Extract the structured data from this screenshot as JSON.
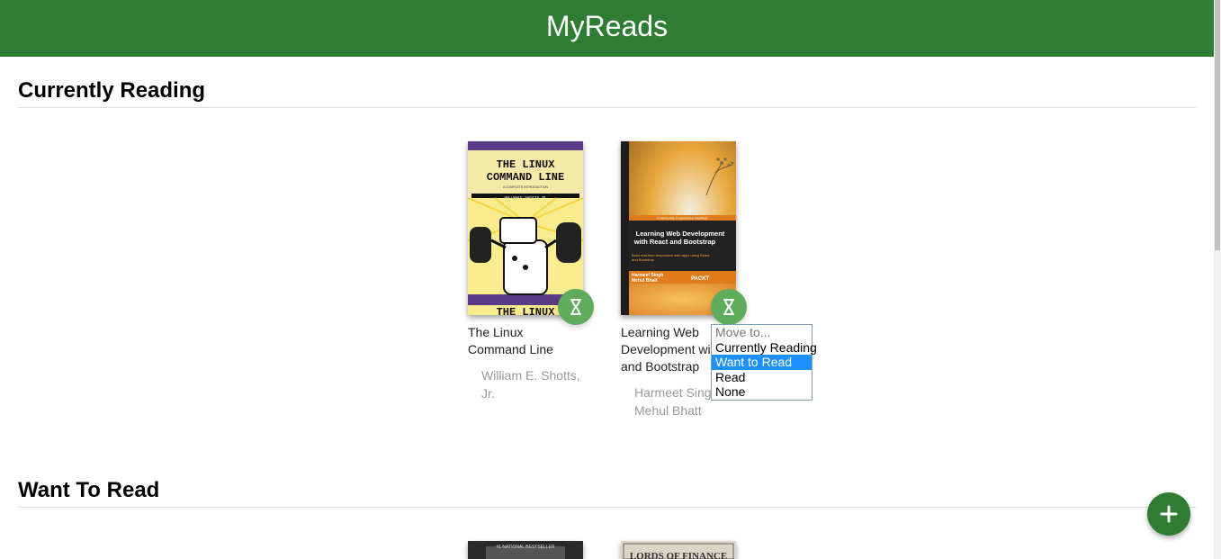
{
  "app": {
    "title": "MyReads"
  },
  "shelves": [
    {
      "title": "Currently Reading",
      "books": [
        {
          "title": "The Linux Command Line",
          "authors": [
            "William E. Shotts, Jr."
          ],
          "cover": {
            "heading_line1": "THE LINUX",
            "heading_line2": "COMMAND LINE",
            "subtitle": "A COMPLETE INTRODUCTION",
            "author": "WILLIAM E. SHOTTS, JR.",
            "bottom": "THE LINUX"
          }
        },
        {
          "title": "Learning Web Development with React and Bootstrap",
          "title_visible": "Learning Web Development with and Bootstrap",
          "authors": [
            "Harmeet Singh",
            "Mehul Bhatt"
          ],
          "cover": {
            "series": "Community Experience Distilled",
            "heading": "Learning Web Development with React and Bootstrap",
            "tagline": "Build real-time responsive web apps using React and Bootstrap",
            "author_line1": "Harmeet Singh",
            "author_line2": "Mehul Bhatt",
            "publisher": "PACKT"
          }
        }
      ]
    },
    {
      "title": "Want To Read",
      "books": [
        {
          "cover": {
            "badge": "#1 NATIONAL BESTSELLER"
          }
        },
        {
          "cover": {
            "heading": "LORDS OF FINANCE"
          }
        }
      ]
    }
  ],
  "shelf_changer_menu": {
    "options": [
      "Move to...",
      "Currently Reading",
      "Want to Read",
      "Read",
      "None"
    ],
    "selected": "Want to Read"
  },
  "colors": {
    "header": "#2e7d32",
    "changer": "#60ac5d",
    "selected_option": "#1e90ff",
    "fab": "#2e7d32"
  },
  "icons": {
    "shelf_changer": "hourglass-icon",
    "add": "plus-icon"
  }
}
